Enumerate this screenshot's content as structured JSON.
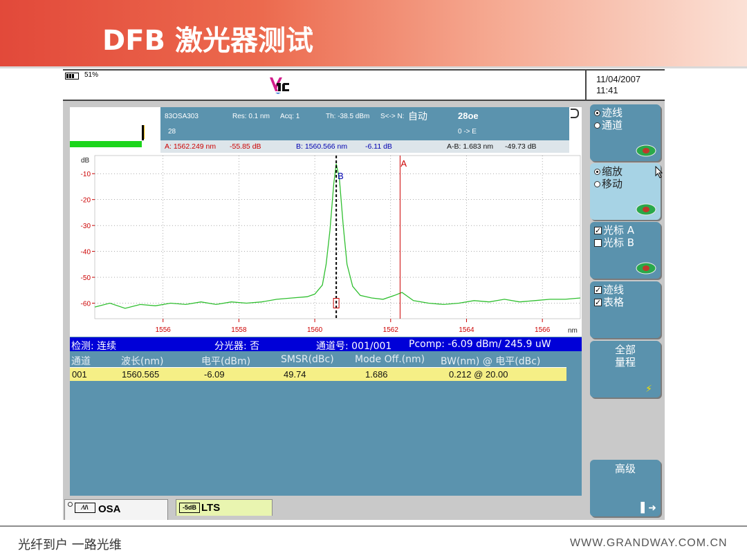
{
  "slide": {
    "title": "DFB 激光器测试"
  },
  "status": {
    "battery": "51%",
    "date": "11/04/2007",
    "time": "11:41"
  },
  "top_info": {
    "model": "83OSA303",
    "res": "Res: 0.1 nm",
    "acq": "Acq: 1",
    "th": "Th: -38.5 dBm",
    "sn_label": "S<-> N:",
    "sn_mode": "自动",
    "count": "28",
    "temp": "28oe",
    "range": "0 -> E"
  },
  "cursors": {
    "a": "A: 1562.249 nm",
    "a_level": "-55.85 dB",
    "b": "B: 1560.566 nm",
    "b_level": "-6.11 dB",
    "ab": "A-B: 1.683 nm",
    "ab_level": "-49.73 dB",
    "a_label": "A",
    "b_label": "B"
  },
  "chart_data": {
    "type": "line",
    "ylabel": "dB",
    "xlabel": "nm",
    "xlim": [
      1554.2,
      1567.0
    ],
    "ylim": [
      -66.0,
      -3.0
    ],
    "x_ticks": [
      "1556",
      "1558",
      "1560",
      "1562",
      "1564",
      "1566"
    ],
    "y_ticks": [
      "-10",
      "-20",
      "-30",
      "-40",
      "-50",
      "-60"
    ],
    "grid": true,
    "cursor_a": 1562.249,
    "cursor_b": 1560.566,
    "colors": {
      "trace": "#2fbf2f",
      "cursor_a": "#cc0000",
      "cursor_b": "#000000"
    },
    "series": [
      {
        "x": [
          1554.2,
          1554.6,
          1555.0,
          1555.4,
          1555.8,
          1556.2,
          1556.6,
          1557.0,
          1557.4,
          1557.8,
          1558.2,
          1558.6,
          1559.0,
          1559.4,
          1559.8,
          1560.0,
          1560.2,
          1560.3,
          1560.4,
          1560.5,
          1560.566,
          1560.65,
          1560.75,
          1560.85,
          1561.0,
          1561.2,
          1561.5,
          1561.8,
          1562.1,
          1562.3,
          1562.6,
          1563.0,
          1563.4,
          1563.8,
          1564.2,
          1564.6,
          1565.0,
          1565.4,
          1565.8,
          1566.2,
          1566.6,
          1567.0
        ],
        "y": [
          -61.5,
          -60.0,
          -62.0,
          -60.5,
          -61.0,
          -60.0,
          -60.5,
          -59.5,
          -60.5,
          -59.5,
          -60.0,
          -59.5,
          -58.5,
          -58.0,
          -57.5,
          -56.5,
          -53.0,
          -45.0,
          -32.0,
          -14.0,
          -6.11,
          -12.0,
          -30.0,
          -45.0,
          -53.5,
          -57.0,
          -58.0,
          -58.5,
          -57.0,
          -55.85,
          -59.0,
          -60.0,
          -60.5,
          -60.0,
          -59.0,
          -59.5,
          -58.5,
          -59.5,
          -59.0,
          -58.5,
          -58.5,
          -58.0
        ]
      }
    ]
  },
  "summary_bar": {
    "detect": "检测: 连续",
    "splitter": "分光器: 否",
    "channel": "通道号: 001/001",
    "pcomp": "Pcomp:  -6.09 dBm/ 245.9 uW"
  },
  "table": {
    "headers": [
      "通道",
      "波长(nm)",
      "电平(dBm)",
      "SMSR(dBc)",
      "Mode Off.(nm)",
      "BW(nm) @ 电平(dBc)"
    ],
    "rows": [
      [
        "001",
        "1560.565",
        "-6.09",
        "49.74",
        "1.686",
        "0.212  @  20.00"
      ]
    ]
  },
  "tabs": {
    "osa_icon": "⁄\\/\\",
    "osa": "OSA",
    "lts_icon": "-5dB",
    "lts": "LTS"
  },
  "softkeys": {
    "k1": {
      "opt1": "迹线",
      "opt2": "通道"
    },
    "k2": {
      "opt1": "缩放",
      "opt2": "移动"
    },
    "k3": {
      "opt1": "光标 A",
      "opt2": "光标 B"
    },
    "k4": {
      "opt1": "迹线",
      "opt2": "表格"
    },
    "k5": {
      "line1": "全部",
      "line2": "量程"
    },
    "k6": {
      "line1": "高级"
    }
  },
  "footer": {
    "left": "光纤到户    一路光维",
    "right": "WWW.GRANDWAY.COM.CN"
  }
}
